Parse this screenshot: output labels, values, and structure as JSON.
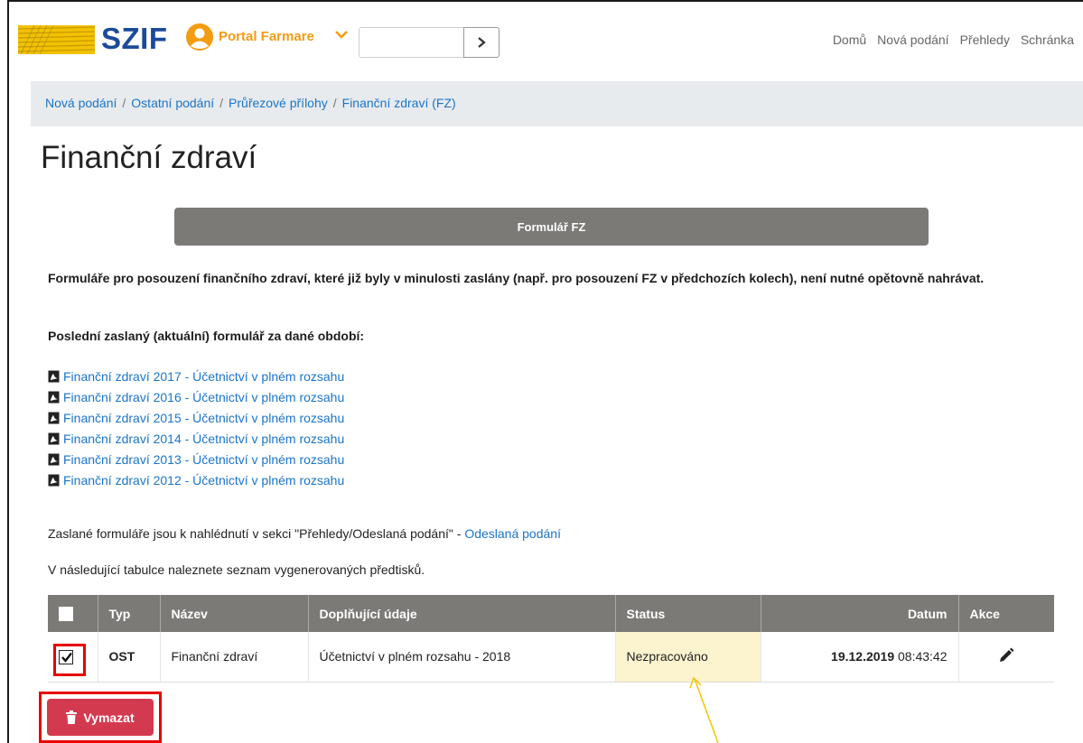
{
  "header": {
    "brand": "SZIF",
    "portal_label": "Portal Farmare",
    "search_value": "",
    "nav": [
      "Domů",
      "Nová podání",
      "Přehledy",
      "Schránka"
    ]
  },
  "breadcrumb": [
    "Nová podání",
    "Ostatní podání",
    "Průřezové přílohy",
    "Finanční zdraví (FZ)"
  ],
  "page_title": "Finanční zdraví",
  "form_button": "Formulář FZ",
  "notice": "Formuláře pro posouzení finančního zdraví, které již byly v minulosti zaslány (např. pro posouzení FZ v předchozích kolech), není nutné opětovně nahrávat.",
  "subheading": "Poslední zaslaný (aktuální) formulář za dané období:",
  "documents": [
    "Finanční zdraví 2017 - Účetnictví v plném rozsahu",
    "Finanční zdraví 2016 - Účetnictví v plném rozsahu",
    "Finanční zdraví 2015 - Účetnictví v plném rozsahu",
    "Finanční zdraví 2014 - Účetnictví v plném rozsahu",
    "Finanční zdraví 2013 - Účetnictví v plném rozsahu",
    "Finanční zdraví 2012 - Účetnictví v plném rozsahu"
  ],
  "info": {
    "sent_text": "Zaslané formuláře jsou k nahlédnutí v sekci \"Přehledy/Odeslaná podání\" - ",
    "sent_link": "Odeslaná podání",
    "table_intro": "V následující tabulce naleznete seznam vygenerovaných předtisků."
  },
  "table": {
    "headers": [
      "Typ",
      "Název",
      "Doplňující údaje",
      "Status",
      "Datum",
      "Akce"
    ],
    "rows": [
      {
        "checked": true,
        "typ": "OST",
        "nazev": "Finanční zdraví",
        "doplnujici": "Účetnictví v plném rozsahu - 2018",
        "status": "Nezpracováno",
        "datum_date": "19.12.2019",
        "datum_time": "08:43:42"
      }
    ]
  },
  "delete_button": "Vymazat",
  "colors": {
    "brand_blue": "#1b4a9a",
    "portal_orange": "#f39c12",
    "link_blue": "#1a75c9",
    "table_header": "#7b7a76",
    "delete_red": "#d43a4f",
    "highlight_red": "#e60000",
    "status_bg": "#fcf3cf",
    "annotation_arrow": "#f5c400"
  },
  "icons": [
    "wheat-logo-icon",
    "user-icon",
    "chevron-down-icon",
    "chevron-right-icon",
    "pdf-icon",
    "pencil-icon",
    "trash-icon",
    "annotation-arrow-icon"
  ]
}
